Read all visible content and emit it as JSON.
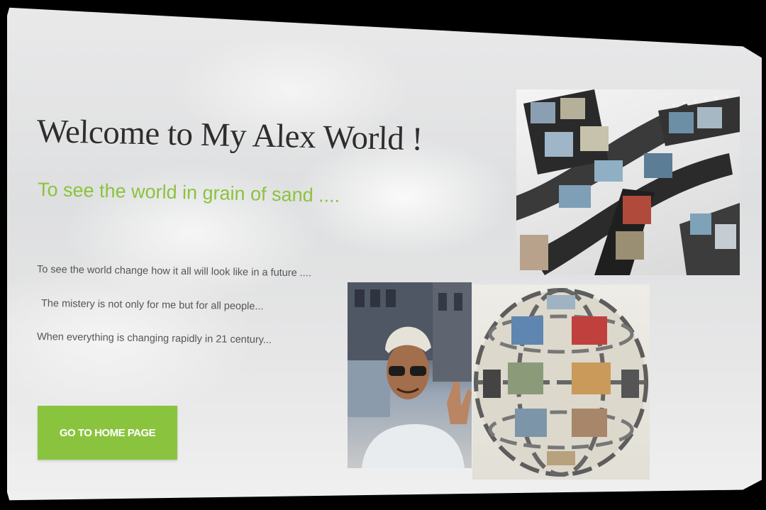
{
  "hero": {
    "title": "Welcome to My Alex World !",
    "subtitle": "To see the world in grain of sand ....",
    "lines": [
      "To see the world change how it all will look like in a future ....",
      "The mistery is not only for me but for all people...",
      "When everything is changing rapidly in 21 century..."
    ],
    "button_label": "GO TO HOME PAGE"
  },
  "images": {
    "film": "film-strip-collage-image",
    "portrait": "portrait-photo",
    "sphere": "photo-sphere-collage-image"
  },
  "colors": {
    "accent_green": "#8ac43f",
    "subtitle_green": "#8cc23e",
    "title_text": "#2e2e2e",
    "body_text": "#555555",
    "backdrop": "#000000"
  }
}
